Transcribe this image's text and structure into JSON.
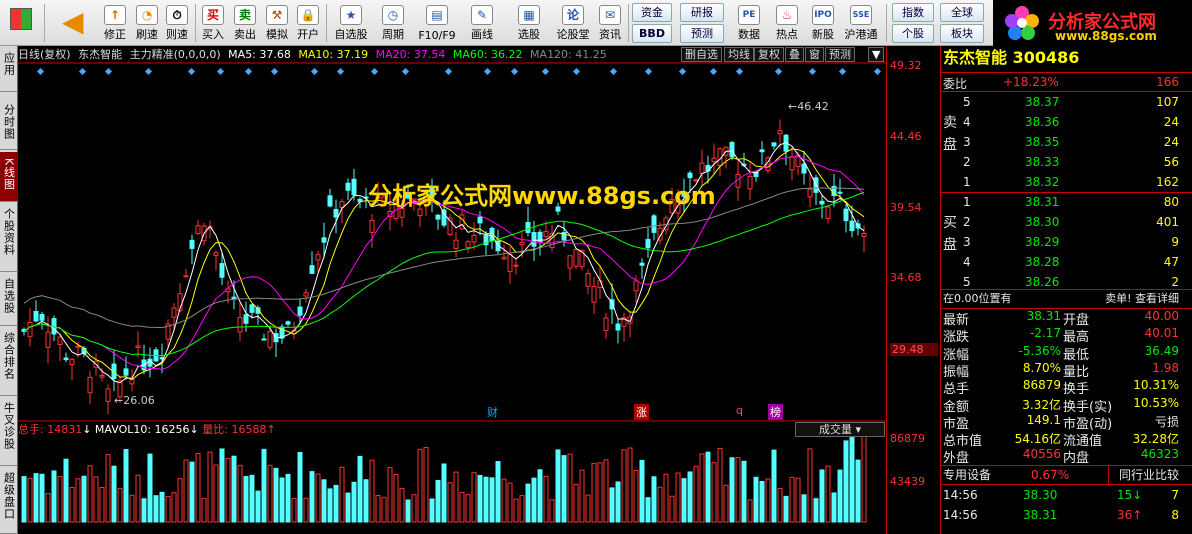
{
  "toolbar": {
    "items": [
      "修正",
      "刷速",
      "买入",
      "卖出",
      "模拟",
      "开户",
      "自选股",
      "周期",
      "F10/F9",
      "画线",
      "选股",
      "论股堂",
      "资讯"
    ],
    "buttons_top": [
      "资金",
      "研报",
      "数据",
      "热点",
      "新股",
      "沪港通",
      "指数",
      "全球"
    ],
    "buttons_bottom": [
      "BBD",
      "预测",
      "个股",
      "板块"
    ]
  },
  "logo": {
    "title": "分析家公式网",
    "url": "www.88gs.com"
  },
  "sidetabs": [
    "应用",
    "分时图",
    "K线图",
    "个股资料",
    "自选股",
    "综合排名",
    "牛叉诊股",
    "超级盘口"
  ],
  "chart_header": {
    "prefix": "日线(复权)",
    "stock": "东杰智能",
    "indicator": "主力精准(0,0,0,0)",
    "ma5": "MA5: 37.68",
    "ma10": "MA10: 37.19",
    "ma20": "MA20: 37.54",
    "ma60": "MA60: 36.22",
    "ma120": "MA120: 41.25",
    "buttons": [
      "删自选",
      "均线",
      "复权",
      "叠",
      "窗",
      "预测"
    ]
  },
  "watermark": "分析家公式网www.88gs.com",
  "annotations": {
    "high": "46.42",
    "low": "26.06",
    "tags": [
      "财",
      "涨",
      "q",
      "榜"
    ]
  },
  "price_axis": [
    "49.32",
    "44.46",
    "39.54",
    "34.68",
    "29.48"
  ],
  "volume_header": {
    "total": "总手: 14831",
    "mavol": "MAVOL10: 16256",
    "ratio": "量比: 16588",
    "button": "成交量"
  },
  "volume_axis": [
    "86879",
    "43439"
  ],
  "colors": {
    "up": "#ff3232",
    "down": "#54ffff",
    "ma5": "#ffffff",
    "ma10": "#ffff00",
    "ma20": "#ff00ff",
    "ma60": "#00ff00",
    "ma120": "#888888"
  },
  "quote": {
    "name": "东杰智能 300486",
    "weibi_label": "委比",
    "weibi": "+18.23%",
    "weicha": "166",
    "sell_label": "卖盘",
    "buy_label": "买盘",
    "asks": [
      {
        "lvl": "5",
        "price": "38.37",
        "vol": "107"
      },
      {
        "lvl": "4",
        "price": "38.36",
        "vol": "24"
      },
      {
        "lvl": "3",
        "price": "38.35",
        "vol": "24"
      },
      {
        "lvl": "2",
        "price": "38.33",
        "vol": "56"
      },
      {
        "lvl": "1",
        "price": "38.32",
        "vol": "162"
      }
    ],
    "bids": [
      {
        "lvl": "1",
        "price": "38.31",
        "vol": "80"
      },
      {
        "lvl": "2",
        "price": "38.30",
        "vol": "401"
      },
      {
        "lvl": "3",
        "price": "38.29",
        "vol": "9"
      },
      {
        "lvl": "4",
        "price": "38.28",
        "vol": "47"
      },
      {
        "lvl": "5",
        "price": "38.26",
        "vol": "2"
      }
    ],
    "position_note": "在0.00位置有",
    "position_link": "卖单! 查看详细",
    "stats": [
      [
        "最新",
        "38.31",
        "开盘",
        "40.00"
      ],
      [
        "涨跌",
        "-2.17",
        "最高",
        "40.01"
      ],
      [
        "涨幅",
        "-5.36%",
        "最低",
        "36.49"
      ],
      [
        "振幅",
        "8.70%",
        "量比",
        "1.98"
      ],
      [
        "总手",
        "86879",
        "换手",
        "10.31%"
      ],
      [
        "金额",
        "3.32亿",
        "换手(实)",
        "10.53%"
      ],
      [
        "市盈",
        "149.1",
        "市盈(动)",
        "亏损"
      ],
      [
        "总市值",
        "54.16亿",
        "流通值",
        "32.28亿"
      ],
      [
        "外盘",
        "40556",
        "内盘",
        "46323"
      ]
    ],
    "industry": "专用设备",
    "industry_pct": "0.67%",
    "compare": "同行业比较",
    "ticks": [
      {
        "time": "14:56",
        "price": "38.30",
        "vol": "15",
        "dir": "↓",
        "n": "7"
      },
      {
        "time": "14:56",
        "price": "38.31",
        "vol": "36",
        "dir": "↑",
        "n": "8"
      }
    ]
  }
}
